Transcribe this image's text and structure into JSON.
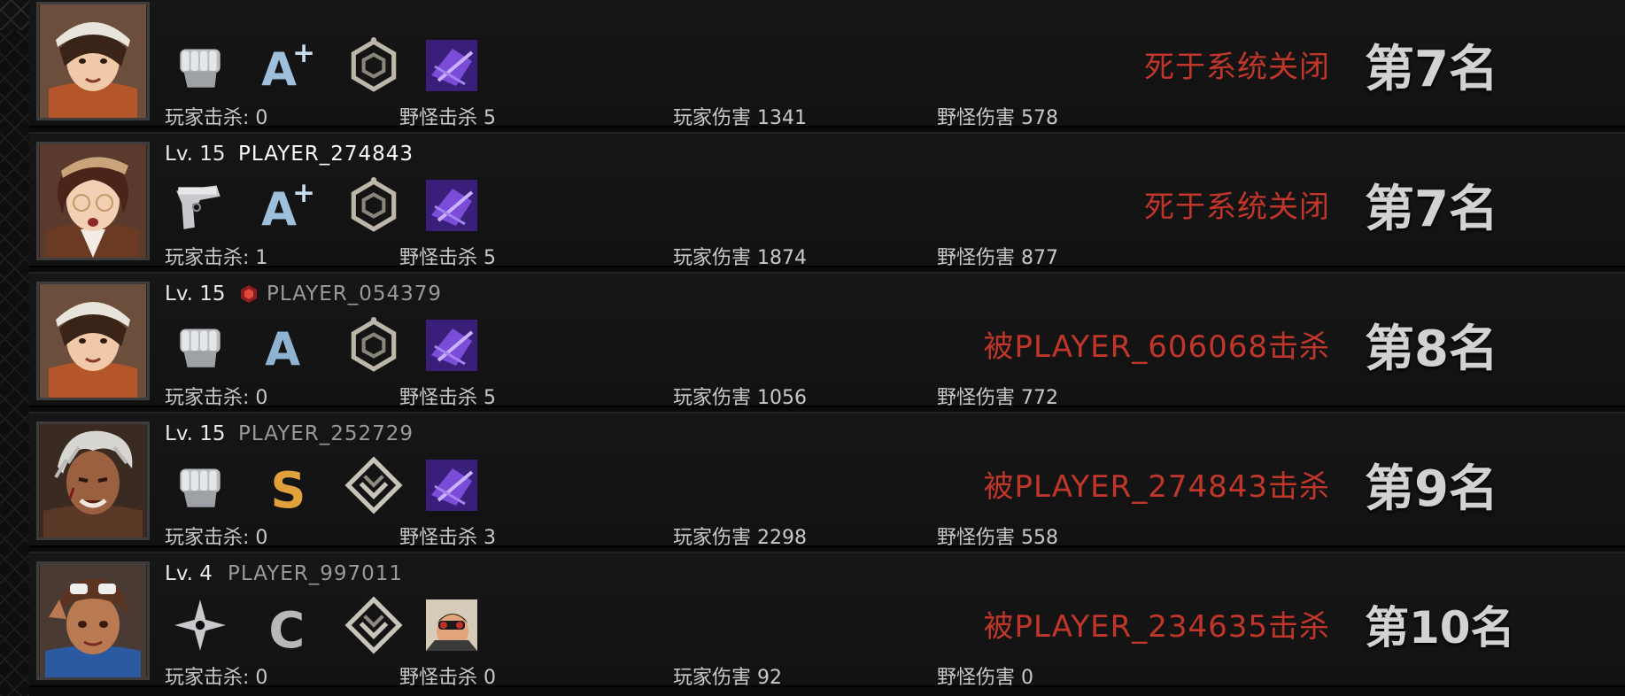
{
  "labels": {
    "player_kills": "玩家击杀:",
    "monster_kills": "野怪击杀",
    "player_damage": "玩家伤害",
    "monster_damage": "野怪伤害"
  },
  "rows": [
    {
      "level_text": "",
      "name": "",
      "name_color": "#ffffff",
      "avatar": "girl-white-cap-avatar",
      "weapon_icon": "fist-icon",
      "grade": "A+",
      "emblem_icon": "hexagon-emblem-icon",
      "skill_icon": "purple-skill-icon",
      "player_kills": "0",
      "monster_kills": "5",
      "player_damage": "1341",
      "monster_damage": "578",
      "death": "死于系统关闭",
      "rank": "第7名"
    },
    {
      "level_text": "Lv. 15",
      "name": "PLAYER_274843",
      "name_color": "#ffffff",
      "avatar": "girl-glasses-beret-avatar",
      "weapon_icon": "pistol-icon",
      "grade": "A+",
      "emblem_icon": "hexagon-emblem-icon",
      "skill_icon": "purple-skill-icon",
      "player_kills": "1",
      "monster_kills": "5",
      "player_damage": "1874",
      "monster_damage": "877",
      "death": "死于系统关闭",
      "rank": "第7名"
    },
    {
      "level_text": "Lv. 15",
      "name": "PLAYER_054379",
      "name_color": "#9a9a9a",
      "badge": "red-crest-badge-icon",
      "avatar": "girl-white-cap-avatar",
      "weapon_icon": "fist-icon",
      "grade": "A",
      "emblem_icon": "hexagon-emblem-icon",
      "skill_icon": "purple-skill-icon",
      "player_kills": "0",
      "monster_kills": "5",
      "player_damage": "1056",
      "monster_damage": "772",
      "death": "被PLAYER_606068击杀",
      "rank": "第8名"
    },
    {
      "level_text": "Lv. 15",
      "name": "PLAYER_252729",
      "name_color": "#9a9a9a",
      "avatar": "man-white-hair-avatar",
      "weapon_icon": "fist-icon",
      "grade": "S",
      "emblem_icon": "diamond-chevron-emblem-icon",
      "skill_icon": "purple-skill-icon",
      "player_kills": "0",
      "monster_kills": "3",
      "player_damage": "2298",
      "monster_damage": "558",
      "death": "被PLAYER_274843击杀",
      "rank": "第9名"
    },
    {
      "level_text": "Lv. 4",
      "name": "PLAYER_997011",
      "name_color": "#9a9a9a",
      "avatar": "girl-sunglasses-avatar",
      "weapon_icon": "shuriken-icon",
      "grade": "C",
      "emblem_icon": "diamond-chevron-emblem-icon",
      "skill_icon": "binoculars-portrait-icon",
      "player_kills": "0",
      "monster_kills": "0",
      "player_damage": "92",
      "monster_damage": "0",
      "death": "被PLAYER_234635击杀",
      "rank": "第10名"
    }
  ]
}
